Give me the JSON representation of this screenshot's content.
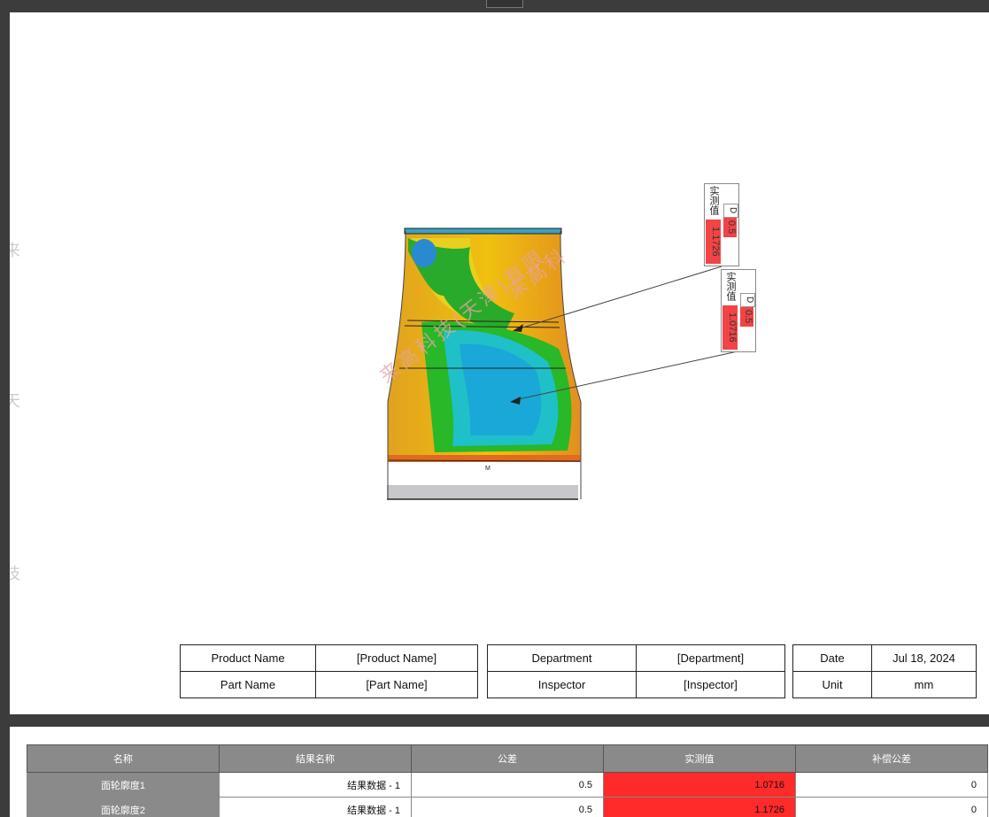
{
  "watermark": "来高科技(天津)有限",
  "callouts": [
    {
      "label": "实测值",
      "value": "1.1726",
      "symbol": "D",
      "tolerance": "0.5"
    },
    {
      "label": "实测值",
      "value": "1.0716",
      "symbol": "D",
      "tolerance": "0.5"
    }
  ],
  "info": {
    "product_name_label": "Product Name",
    "product_name_value": "[Product Name]",
    "part_name_label": "Part Name",
    "part_name_value": "[Part Name]",
    "department_label": "Department",
    "department_value": "[Department]",
    "inspector_label": "Inspector",
    "inspector_value": "[Inspector]",
    "date_label": "Date",
    "date_value": "Jul 18, 2024",
    "unit_label": "Unit",
    "unit_value": "mm"
  },
  "results": {
    "headers": [
      "名称",
      "结果名称",
      "公差",
      "实测值",
      "补偿公差"
    ],
    "rows": [
      {
        "name": "面轮廓度1",
        "result": "结果数据 - 1",
        "tolerance": "0.5",
        "measured": "1.0716",
        "compensation": "0"
      },
      {
        "name": "面轮廓度2",
        "result": "结果数据 - 1",
        "tolerance": "0.5",
        "measured": "1.1726",
        "compensation": "0"
      }
    ]
  },
  "colors": {
    "out_of_tolerance": "#ff2a2a",
    "header_gray": "#8a8a8a"
  }
}
